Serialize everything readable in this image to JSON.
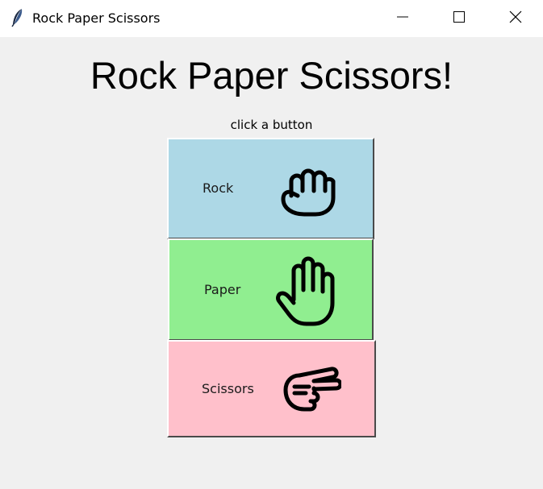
{
  "window": {
    "title": "Rock Paper Scissors",
    "icon": "feather-icon",
    "controls": [
      "minimize-icon",
      "maximize-icon",
      "close-icon"
    ]
  },
  "main": {
    "heading": "Rock Paper Scissors!",
    "subtitle": "click a button",
    "buttons": [
      {
        "label": "Rock",
        "icon": "fist-icon",
        "color": "#add8e6"
      },
      {
        "label": "Paper",
        "icon": "open-hand-icon",
        "color": "#90ee90"
      },
      {
        "label": "Scissors",
        "icon": "scissors-hand-icon",
        "color": "#ffc0cb"
      }
    ]
  }
}
